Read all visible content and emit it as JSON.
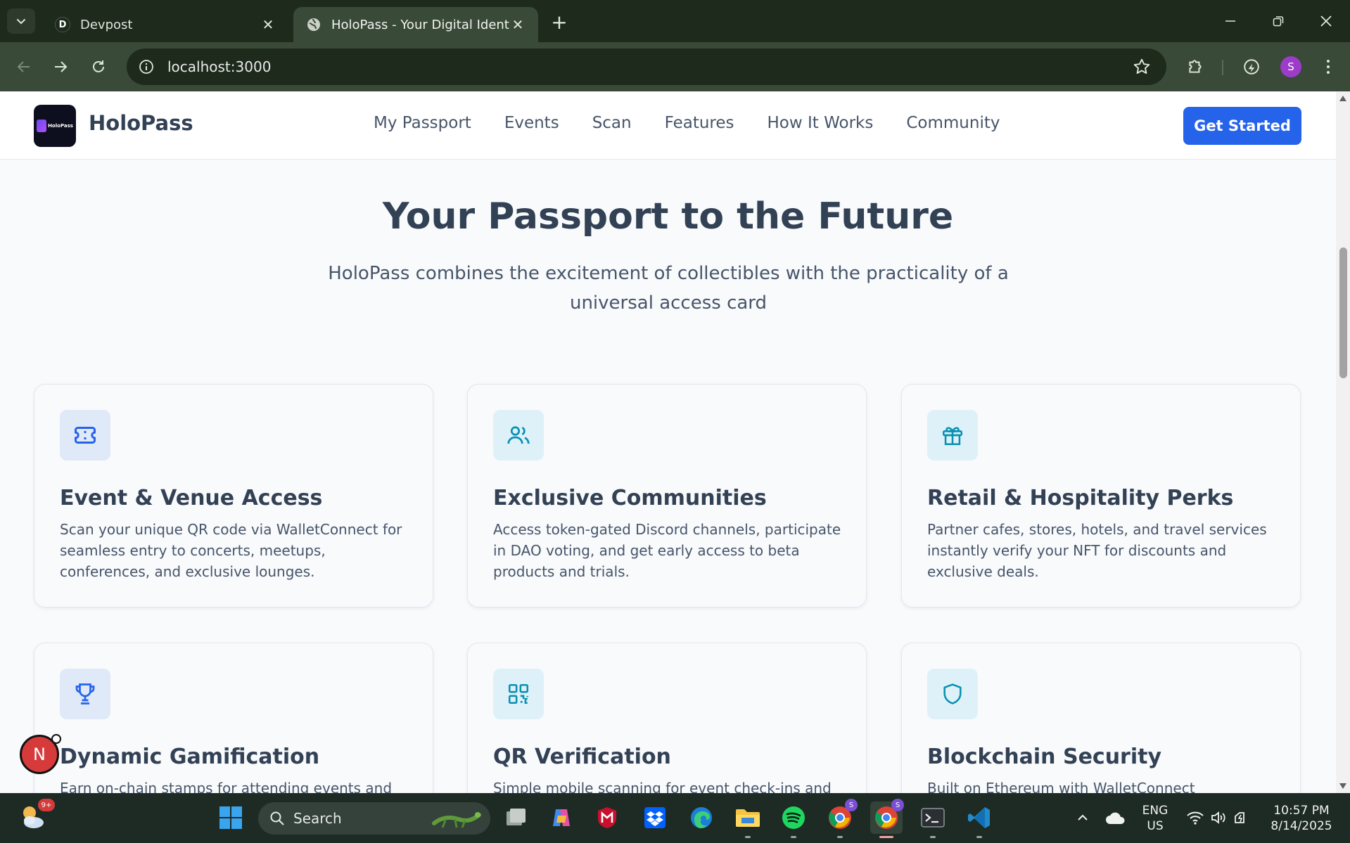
{
  "browser": {
    "tabs": [
      {
        "title": "Devpost",
        "favicon_letter": "D",
        "active": false
      },
      {
        "title": "HoloPass - Your Digital Identity",
        "active": true
      }
    ],
    "url": "localhost:3000",
    "profile_initial": "S"
  },
  "site": {
    "brand": "HoloPass",
    "logo_text": "HoloPass",
    "nav": [
      "My Passport",
      "Events",
      "Scan",
      "Features",
      "How It Works",
      "Community"
    ],
    "cta": "Get Started"
  },
  "hero": {
    "title": "Your Passport to the Future",
    "subtitle": "HoloPass combines the excitement of collectibles with the practicality of a universal access card"
  },
  "features": [
    {
      "icon": "ticket-icon",
      "title": "Event & Venue Access",
      "text": "Scan your unique QR code via WalletConnect for seamless entry to concerts, meetups, conferences, and exclusive lounges."
    },
    {
      "icon": "users-icon",
      "title": "Exclusive Communities",
      "text": "Access token-gated Discord channels, participate in DAO voting, and get early access to beta products and trials."
    },
    {
      "icon": "gift-icon",
      "title": "Retail & Hospitality Perks",
      "text": "Partner cafes, stores, hotels, and travel services instantly verify your NFT for discounts and exclusive deals."
    },
    {
      "icon": "trophy-icon",
      "title": "Dynamic Gamification",
      "text": "Earn on-chain stamps for attending events and"
    },
    {
      "icon": "qr-code-icon",
      "title": "QR Verification",
      "text": "Simple mobile scanning for event check-ins and"
    },
    {
      "icon": "shield-icon",
      "title": "Blockchain Security",
      "text": "Built on Ethereum with WalletConnect integration."
    }
  ],
  "floating_badge": "N",
  "taskbar": {
    "search_label": "Search",
    "weather_badge": "9+",
    "chrome_badge": "S",
    "language": "ENG",
    "region": "US",
    "time": "10:57 PM",
    "date": "8/14/2025"
  },
  "colors": {
    "accent": "#2563eb",
    "heading": "#334155",
    "body": "#475569"
  }
}
